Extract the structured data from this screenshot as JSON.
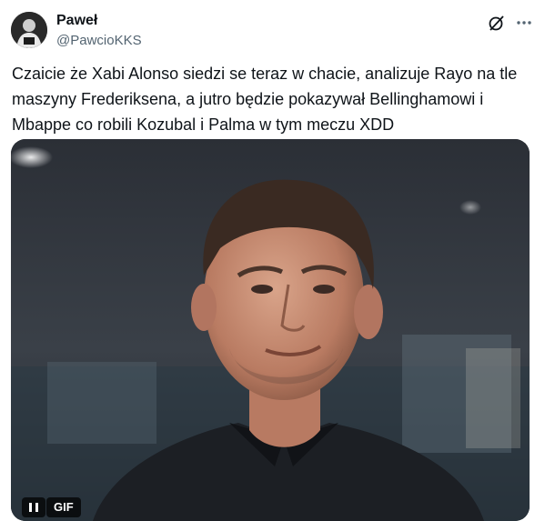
{
  "author": {
    "display_name": "Paweł",
    "handle": "@PawcioKKS",
    "avatar_icon": "avatar-photo"
  },
  "actions": {
    "grok_icon": "grok-icon",
    "more_icon": "more-icon"
  },
  "tweet": {
    "text": "Czaicie że Xabi Alonso siedzi se teraz w chacie, analizuje Rayo na tle\nmaszyny Frederiksena, a jutro będzie pokazywał Bellinghamowi i\nMbappe co robili Kozubal i Palma w tym meczu XDD"
  },
  "media": {
    "badge_label": "GIF",
    "pause_icon": "pause-icon"
  },
  "colors": {
    "text": "#0f1419",
    "secondary": "#536471"
  }
}
